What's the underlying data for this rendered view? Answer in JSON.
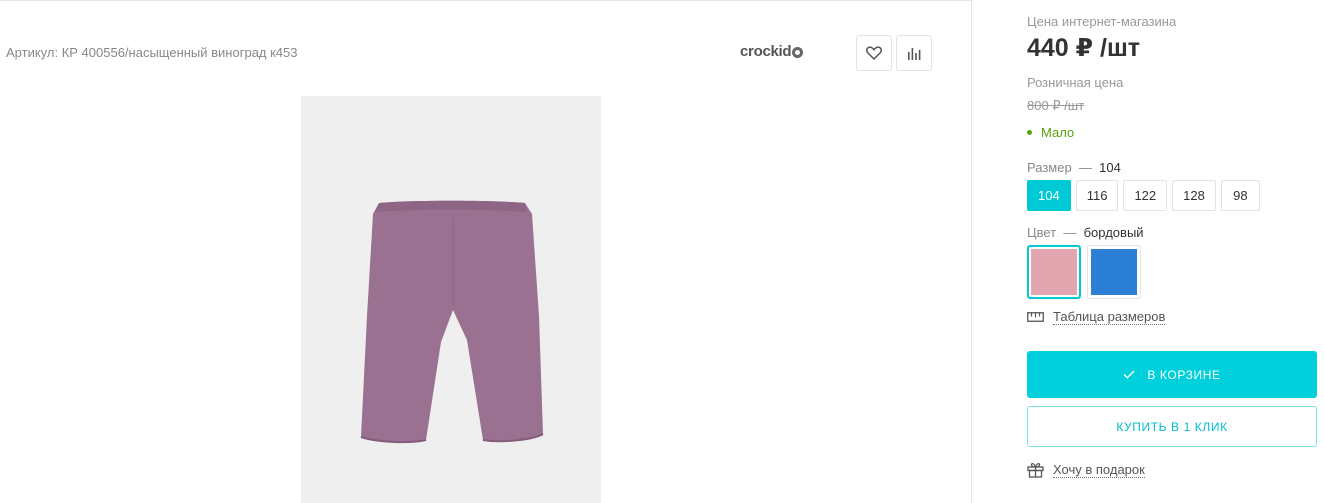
{
  "product": {
    "article": "Артикул: КР 400556/насыщенный виноград к453",
    "brand": "crockid"
  },
  "actions": {
    "favorite_icon": "heart-icon",
    "compare_icon": "bar-chart-icon"
  },
  "pricing": {
    "online_label": "Цена интернет-магазина",
    "online_price": "440 ₽ /шт",
    "retail_label": "Розничная цена",
    "retail_price": "800 ₽ /шт",
    "stock_status": "Мало",
    "stock_color": "#5aa10f"
  },
  "size": {
    "label": "Размер",
    "dash": "—",
    "selected": "104",
    "options": [
      "104",
      "116",
      "122",
      "128",
      "98"
    ]
  },
  "color": {
    "label": "Цвет",
    "dash": "—",
    "selected": "бордовый",
    "swatches": [
      "#e2a6b1",
      "#2b7fd4"
    ]
  },
  "size_table": {
    "label": "Таблица размеров",
    "icon": "ruler-icon"
  },
  "buttons": {
    "cart": "В КОРЗИНЕ",
    "cart_icon": "check-icon",
    "one_click": "КУПИТЬ В 1 КЛИК"
  },
  "gift": {
    "label": "Хочу в подарок",
    "icon": "gift-icon"
  },
  "colors": {
    "accent": "#00d0dc",
    "product": "#9a7190"
  }
}
